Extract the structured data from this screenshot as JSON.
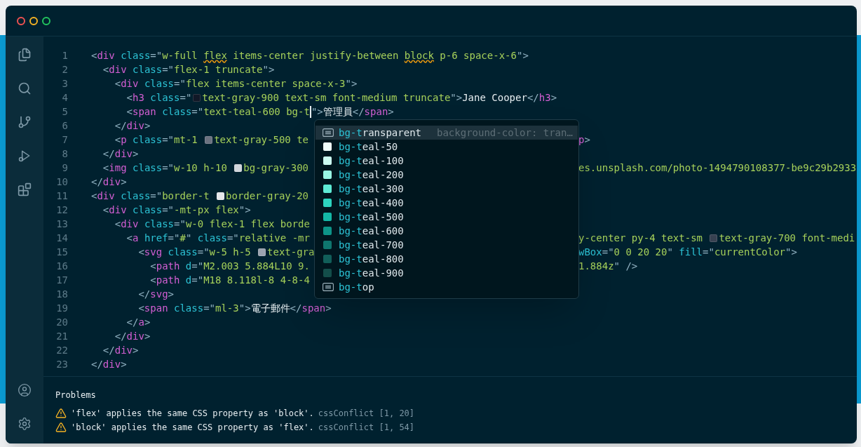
{
  "window": {
    "controls": [
      {
        "color": "#f05252"
      },
      {
        "color": "#f5b324"
      },
      {
        "color": "#22c55e"
      }
    ]
  },
  "sidebar": {
    "items": [
      {
        "kind": "files",
        "selected": false
      },
      {
        "kind": "search",
        "selected": false
      },
      {
        "kind": "branch",
        "selected": false
      },
      {
        "kind": "debug",
        "selected": false
      },
      {
        "kind": "extensions",
        "selected": false
      }
    ],
    "bottom": [
      {
        "kind": "account"
      },
      {
        "kind": "settings"
      }
    ]
  },
  "editor": {
    "lines": [
      {
        "number": "1",
        "tokens": [
          {
            "kind": "punct",
            "text": "<"
          },
          {
            "kind": "tag",
            "text": "div"
          },
          {
            "kind": "attr",
            "text": " class"
          },
          {
            "kind": "punct",
            "text": "=\""
          },
          {
            "kind": "string",
            "text": "w-full "
          },
          {
            "kind": "string",
            "text": "flex",
            "warning": true
          },
          {
            "kind": "string",
            "text": " items-center justify-between "
          },
          {
            "kind": "string",
            "text": "block",
            "warning": true
          },
          {
            "kind": "string",
            "text": " p-6 space-x-6"
          },
          {
            "kind": "punct",
            "text": "\">"
          }
        ]
      },
      {
        "number": "2",
        "tokens": [
          {
            "kind": "punct",
            "text": "  <"
          },
          {
            "kind": "tag",
            "text": "div"
          },
          {
            "kind": "attr",
            "text": " class"
          },
          {
            "kind": "punct",
            "text": "=\""
          },
          {
            "kind": "string",
            "text": "flex-1 truncate"
          },
          {
            "kind": "punct",
            "text": "\">"
          }
        ]
      },
      {
        "number": "3",
        "tokens": [
          {
            "kind": "punct",
            "text": "    <"
          },
          {
            "kind": "tag",
            "text": "div"
          },
          {
            "kind": "attr",
            "text": " class"
          },
          {
            "kind": "punct",
            "text": "=\""
          },
          {
            "kind": "string",
            "text": "flex items-center space-x-3"
          },
          {
            "kind": "punct",
            "text": "\">"
          }
        ]
      },
      {
        "number": "4",
        "tokens": [
          {
            "kind": "punct",
            "text": "      <"
          },
          {
            "kind": "tag",
            "text": "h3"
          },
          {
            "kind": "attr",
            "text": " class"
          },
          {
            "kind": "punct",
            "text": "=\""
          },
          {
            "kind": "swatch",
            "color": "#111827"
          },
          {
            "kind": "string",
            "text": "text-gray-900 text-sm font-medium truncate"
          },
          {
            "kind": "punct",
            "text": "\">"
          },
          {
            "kind": "text",
            "text": "Jane Cooper"
          },
          {
            "kind": "punct",
            "text": "</"
          },
          {
            "kind": "tag",
            "text": "h3"
          },
          {
            "kind": "punct",
            "text": ">"
          }
        ]
      },
      {
        "number": "5",
        "tokens": [
          {
            "kind": "punct",
            "text": "      <"
          },
          {
            "kind": "tag",
            "text": "span"
          },
          {
            "kind": "attr",
            "text": " class"
          },
          {
            "kind": "punct",
            "text": "=\""
          },
          {
            "kind": "string",
            "text": "text-teal-600 bg-t"
          },
          {
            "kind": "cursor"
          },
          {
            "kind": "punct",
            "text": "\">"
          },
          {
            "kind": "text",
            "text": "管理員"
          },
          {
            "kind": "punct",
            "text": "</"
          },
          {
            "kind": "tag",
            "text": "span"
          },
          {
            "kind": "punct",
            "text": ">"
          }
        ]
      },
      {
        "number": "6",
        "tokens": [
          {
            "kind": "punct",
            "text": "    </"
          },
          {
            "kind": "tag",
            "text": "div"
          },
          {
            "kind": "punct",
            "text": ">"
          }
        ]
      },
      {
        "number": "7",
        "tokens": [
          {
            "kind": "punct",
            "text": "    <"
          },
          {
            "kind": "tag",
            "text": "p"
          },
          {
            "kind": "attr",
            "text": " class"
          },
          {
            "kind": "punct",
            "text": "=\""
          },
          {
            "kind": "string",
            "text": "mt-1 "
          },
          {
            "kind": "swatch",
            "color": "#6b7280"
          },
          {
            "kind": "string",
            "text": "text-gray-500 te"
          }
        ],
        "tail": [
          {
            "kind": "tag",
            "text": "p"
          },
          {
            "kind": "punct",
            "text": ">"
          }
        ]
      },
      {
        "number": "8",
        "tokens": [
          {
            "kind": "punct",
            "text": "  </"
          },
          {
            "kind": "tag",
            "text": "div"
          },
          {
            "kind": "punct",
            "text": ">"
          }
        ]
      },
      {
        "number": "9",
        "tokens": [
          {
            "kind": "punct",
            "text": "  <"
          },
          {
            "kind": "tag",
            "text": "img"
          },
          {
            "kind": "attr",
            "text": " class"
          },
          {
            "kind": "punct",
            "text": "=\""
          },
          {
            "kind": "string",
            "text": "w-10 h-10 "
          },
          {
            "kind": "swatch",
            "color": "#d1d5db"
          },
          {
            "kind": "string",
            "text": "bg-gray-300"
          }
        ],
        "tail": [
          {
            "kind": "string",
            "text": "es.unsplash.com/photo-1494790108377-be9c29b2933"
          }
        ]
      },
      {
        "number": "10",
        "tokens": [
          {
            "kind": "punct",
            "text": "</"
          },
          {
            "kind": "tag",
            "text": "div"
          },
          {
            "kind": "punct",
            "text": ">"
          }
        ]
      },
      {
        "number": "11",
        "tokens": [
          {
            "kind": "punct",
            "text": "<"
          },
          {
            "kind": "tag",
            "text": "div"
          },
          {
            "kind": "attr",
            "text": " class"
          },
          {
            "kind": "punct",
            "text": "=\""
          },
          {
            "kind": "string",
            "text": "border-t "
          },
          {
            "kind": "swatch",
            "color": "#e5e7eb"
          },
          {
            "kind": "string",
            "text": "border-gray-20"
          }
        ]
      },
      {
        "number": "12",
        "tokens": [
          {
            "kind": "punct",
            "text": "  <"
          },
          {
            "kind": "tag",
            "text": "div"
          },
          {
            "kind": "attr",
            "text": " class"
          },
          {
            "kind": "punct",
            "text": "=\""
          },
          {
            "kind": "string",
            "text": "-mt-px flex"
          },
          {
            "kind": "punct",
            "text": "\">"
          }
        ]
      },
      {
        "number": "13",
        "tokens": [
          {
            "kind": "punct",
            "text": "    <"
          },
          {
            "kind": "tag",
            "text": "div"
          },
          {
            "kind": "attr",
            "text": " class"
          },
          {
            "kind": "punct",
            "text": "=\""
          },
          {
            "kind": "string",
            "text": "w-0 flex-1 flex borde"
          }
        ]
      },
      {
        "number": "14",
        "tokens": [
          {
            "kind": "punct",
            "text": "      <"
          },
          {
            "kind": "tag",
            "text": "a"
          },
          {
            "kind": "attr",
            "text": " href"
          },
          {
            "kind": "punct",
            "text": "=\""
          },
          {
            "kind": "string",
            "text": "#"
          },
          {
            "kind": "punct",
            "text": "\""
          },
          {
            "kind": "attr",
            "text": " class"
          },
          {
            "kind": "punct",
            "text": "=\""
          },
          {
            "kind": "string",
            "text": "relative -mr"
          }
        ],
        "tail": [
          {
            "kind": "string",
            "text": "y-center py-4 text-sm "
          },
          {
            "kind": "swatch",
            "color": "#374151"
          },
          {
            "kind": "string",
            "text": "text-gray-700 font-medi"
          }
        ]
      },
      {
        "number": "15",
        "tokens": [
          {
            "kind": "punct",
            "text": "        <"
          },
          {
            "kind": "tag",
            "text": "svg"
          },
          {
            "kind": "attr",
            "text": " class"
          },
          {
            "kind": "punct",
            "text": "=\""
          },
          {
            "kind": "string",
            "text": "w-5 h-5 "
          },
          {
            "kind": "swatch",
            "color": "#9ca3af"
          },
          {
            "kind": "string",
            "text": "text-gra"
          }
        ],
        "tail": [
          {
            "kind": "attr",
            "text": "wBox"
          },
          {
            "kind": "punct",
            "text": "=\""
          },
          {
            "kind": "string",
            "text": "0 0 20 20"
          },
          {
            "kind": "punct",
            "text": "\""
          },
          {
            "kind": "attr",
            "text": " fill"
          },
          {
            "kind": "punct",
            "text": "=\""
          },
          {
            "kind": "string",
            "text": "currentColor"
          },
          {
            "kind": "punct",
            "text": "\">"
          }
        ]
      },
      {
        "number": "16",
        "tokens": [
          {
            "kind": "punct",
            "text": "          <"
          },
          {
            "kind": "tag",
            "text": "path"
          },
          {
            "kind": "attr",
            "text": " d"
          },
          {
            "kind": "punct",
            "text": "=\""
          },
          {
            "kind": "string",
            "text": "M2.003 5.884L10 9."
          }
        ],
        "tail": [
          {
            "kind": "string",
            "text": "1.884z"
          },
          {
            "kind": "punct",
            "text": "\" />"
          }
        ]
      },
      {
        "number": "17",
        "tokens": [
          {
            "kind": "punct",
            "text": "          <"
          },
          {
            "kind": "tag",
            "text": "path"
          },
          {
            "kind": "attr",
            "text": " d"
          },
          {
            "kind": "punct",
            "text": "=\""
          },
          {
            "kind": "string",
            "text": "M18 8.118l-8 4-8-4"
          }
        ]
      },
      {
        "number": "18",
        "tokens": [
          {
            "kind": "punct",
            "text": "        </"
          },
          {
            "kind": "tag",
            "text": "svg"
          },
          {
            "kind": "punct",
            "text": ">"
          }
        ]
      },
      {
        "number": "19",
        "tokens": [
          {
            "kind": "punct",
            "text": "        <"
          },
          {
            "kind": "tag",
            "text": "span"
          },
          {
            "kind": "attr",
            "text": " class"
          },
          {
            "kind": "punct",
            "text": "=\""
          },
          {
            "kind": "string",
            "text": "ml-3"
          },
          {
            "kind": "punct",
            "text": "\">"
          },
          {
            "kind": "text",
            "text": "電子郵件"
          },
          {
            "kind": "punct",
            "text": "</"
          },
          {
            "kind": "tag",
            "text": "span"
          },
          {
            "kind": "punct",
            "text": ">"
          }
        ]
      },
      {
        "number": "20",
        "tokens": [
          {
            "kind": "punct",
            "text": "      </"
          },
          {
            "kind": "tag",
            "text": "a"
          },
          {
            "kind": "punct",
            "text": ">"
          }
        ]
      },
      {
        "number": "21",
        "tokens": [
          {
            "kind": "punct",
            "text": "    </"
          },
          {
            "kind": "tag",
            "text": "div"
          },
          {
            "kind": "punct",
            "text": ">"
          }
        ]
      },
      {
        "number": "22",
        "tokens": [
          {
            "kind": "punct",
            "text": "  </"
          },
          {
            "kind": "tag",
            "text": "div"
          },
          {
            "kind": "punct",
            "text": ">"
          }
        ]
      },
      {
        "number": "23",
        "tokens": [
          {
            "kind": "punct",
            "text": "</"
          },
          {
            "kind": "tag",
            "text": "div"
          },
          {
            "kind": "punct",
            "text": ">"
          }
        ]
      }
    ]
  },
  "suggestions": [
    {
      "kind": "keyword",
      "match": "bg-t",
      "rest": "ransparent",
      "detail": "background-color: tran…",
      "selected": true
    },
    {
      "kind": "color",
      "color": "#f0fdfa",
      "match": "bg-t",
      "rest": "eal-50",
      "selected": false
    },
    {
      "kind": "color",
      "color": "#ccfbf1",
      "match": "bg-t",
      "rest": "eal-100",
      "selected": false
    },
    {
      "kind": "color",
      "color": "#99f6e4",
      "match": "bg-t",
      "rest": "eal-200",
      "selected": false
    },
    {
      "kind": "color",
      "color": "#5eead4",
      "match": "bg-t",
      "rest": "eal-300",
      "selected": false
    },
    {
      "kind": "color",
      "color": "#2dd4bf",
      "match": "bg-t",
      "rest": "eal-400",
      "selected": false
    },
    {
      "kind": "color",
      "color": "#14b8a6",
      "match": "bg-t",
      "rest": "eal-500",
      "selected": false
    },
    {
      "kind": "color",
      "color": "#0d9488",
      "match": "bg-t",
      "rest": "eal-600",
      "selected": false
    },
    {
      "kind": "color",
      "color": "#0f766e",
      "match": "bg-t",
      "rest": "eal-700",
      "selected": false
    },
    {
      "kind": "color",
      "color": "#115e59",
      "match": "bg-t",
      "rest": "eal-800",
      "selected": false
    },
    {
      "kind": "color",
      "color": "#134e4a",
      "match": "bg-t",
      "rest": "eal-900",
      "selected": false
    },
    {
      "kind": "keyword",
      "match": "bg-t",
      "rest": "op",
      "selected": false
    }
  ],
  "problems": {
    "title": "Problems",
    "items": [
      {
        "message": "'flex' applies the same CSS property as 'block'.",
        "source": "cssConflict [1, 20]"
      },
      {
        "message": "'block' applies the same CSS property as 'flex'.",
        "source": "cssConflict [1, 54]"
      }
    ]
  }
}
